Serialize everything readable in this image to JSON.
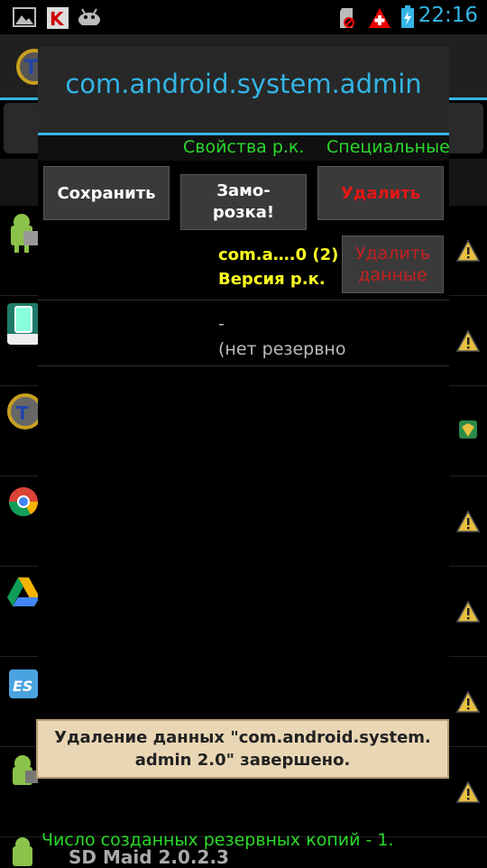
{
  "status_bar": {
    "time": "22:16",
    "icons": [
      "image-icon",
      "kaspersky-icon",
      "android-icon",
      "sd-card-icon",
      "swiss-flag-icon",
      "battery-icon"
    ]
  },
  "background_list": {
    "bottom_app_name": "SD Maid 2.0.2.3",
    "row_icons": [
      "android-box-icon",
      "kaspersky-app-icon",
      "titanium-icon",
      "chrome-icon",
      "drive-icon",
      "es-explorer-icon",
      "android-icon"
    ]
  },
  "dialog": {
    "title": "com.android.system.admin",
    "tabs": [
      "Свойства р.к.",
      "Специальные"
    ],
    "buttons": {
      "save": "Сохранить",
      "freeze": "Замо-\nрозка!",
      "delete": "Удалить",
      "delete_data": "Удалить\nданные"
    },
    "backup_name": "com.a….0 (2)",
    "backup_version_label": "Версия р.к.",
    "backup_dash": "-",
    "backup_none": "(нет резервно"
  },
  "toast": {
    "message": "Удаление данных \"com.android.system.\nadmin 2.0\" завершено."
  },
  "footer": {
    "backup_count_message": "Число созданных резервных копий - 1."
  },
  "colors": {
    "accent": "#33b5e5",
    "tab_green": "#2bd92b",
    "delete_red": "#e51616",
    "info_yellow": "#ffff22",
    "toast_bg": "#e9d6b4"
  }
}
